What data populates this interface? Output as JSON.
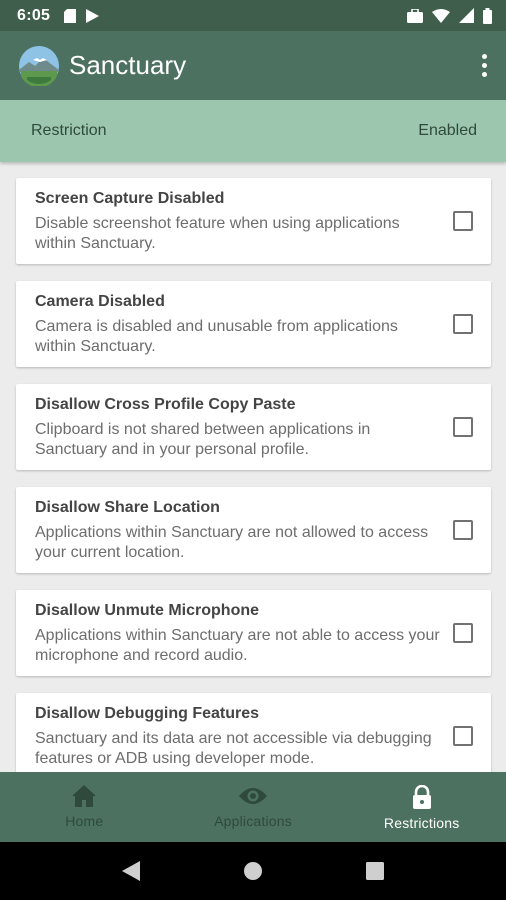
{
  "status_bar": {
    "time": "6:05"
  },
  "app_bar": {
    "title": "Sanctuary"
  },
  "header": {
    "left_label": "Restriction",
    "right_label": "Enabled"
  },
  "restrictions": [
    {
      "title": "Screen Capture Disabled",
      "description": "Disable screenshot feature when using applications within Sanctuary.",
      "enabled": false
    },
    {
      "title": "Camera Disabled",
      "description": "Camera is disabled and unusable from applications within Sanctuary.",
      "enabled": false
    },
    {
      "title": "Disallow Cross Profile Copy Paste",
      "description": "Clipboard is not shared between applications in Sanctuary and in your personal profile.",
      "enabled": false
    },
    {
      "title": "Disallow Share Location",
      "description": "Applications within Sanctuary are not allowed to access your current location.",
      "enabled": false
    },
    {
      "title": "Disallow Unmute Microphone",
      "description": "Applications within Sanctuary are not able to access your microphone and record audio.",
      "enabled": false
    },
    {
      "title": "Disallow Debugging Features",
      "description": "Sanctuary and its data are not accessible via debugging features or ADB using developer mode.",
      "enabled": false
    }
  ],
  "bottom_nav": [
    {
      "label": "Home",
      "icon": "home-icon",
      "active": false
    },
    {
      "label": "Applications",
      "icon": "eye-icon",
      "active": false
    },
    {
      "label": "Restrictions",
      "icon": "lock-icon",
      "active": true
    }
  ],
  "colors": {
    "status_bar": "#3f5f4c",
    "app_bar": "#4d7160",
    "header_row": "#9cc6ad",
    "inactive_nav": "#2f4a3c",
    "active_nav": "#ffffff"
  }
}
